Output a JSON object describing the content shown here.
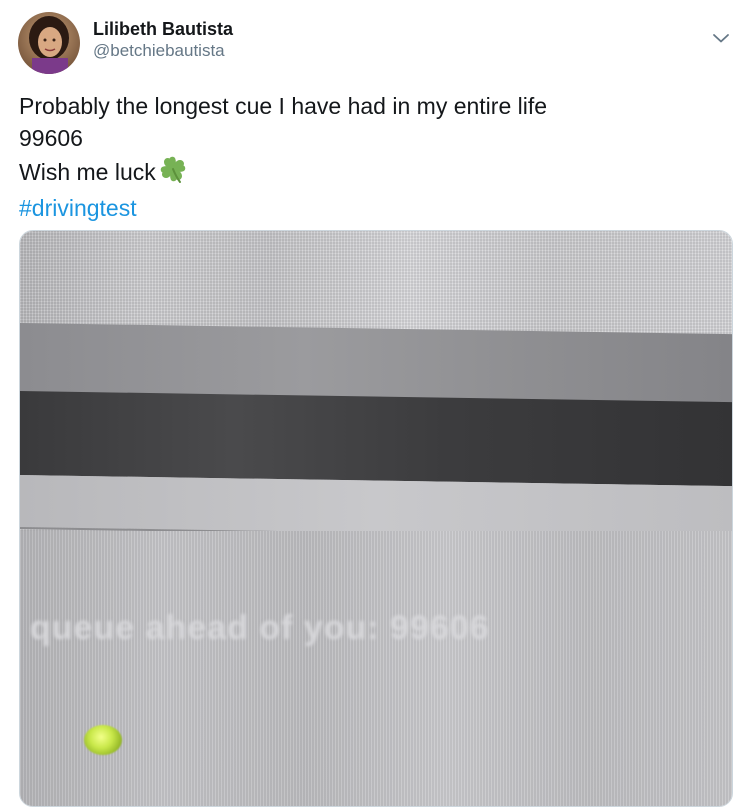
{
  "tweet": {
    "author": {
      "display_name": "Lilibeth Bautista",
      "handle": "@betchiebautista"
    },
    "text_lines": [
      "Probably the longest cue I have had in my entire life",
      "99606",
      "Wish me luck"
    ],
    "emoji": "four-leaf-clover-icon",
    "hashtag": "#drivingtest",
    "media": {
      "screen_text": "queue ahead of you: 99606"
    }
  },
  "colors": {
    "text": "#14171a",
    "secondary": "#657786",
    "link": "#1b95e0",
    "border": "#ccd6dd"
  }
}
